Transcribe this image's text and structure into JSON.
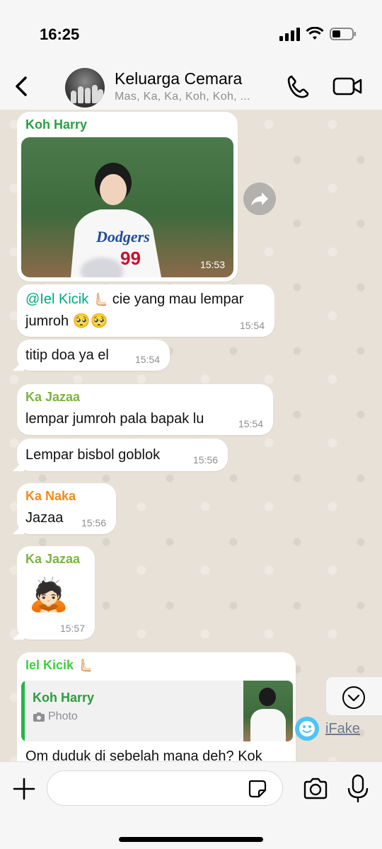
{
  "status": {
    "time": "16:25"
  },
  "header": {
    "title": "Keluarga Cemara",
    "members": "Mas, Ka, Ka, Koh, Koh, ..."
  },
  "messages": [
    {
      "sender": "Koh Harry",
      "sender_color": "#25a244",
      "type": "photo",
      "time": "15:53"
    },
    {
      "mention": "@Iel Kicik",
      "mention_emoji": "🫷🏻",
      "text_line1": " cie yang mau lempar",
      "text_line2": "jumroh 🥺🥺",
      "time": "15:54"
    },
    {
      "text": "titip doa ya el",
      "time": "15:54"
    },
    {
      "sender": "Ka Jazaa",
      "sender_color": "#7cb342",
      "text": "lempar jumroh pala bapak lu",
      "time": "15:54"
    },
    {
      "text": "Lempar bisbol goblok",
      "time": "15:56"
    },
    {
      "sender": "Ka Naka",
      "sender_color": "#f08c1a",
      "text": "Jazaa",
      "time": "15:56"
    },
    {
      "sender": "Ka Jazaa",
      "sender_color": "#7cb342",
      "sticker": "🙇🏻",
      "time": "15:57"
    },
    {
      "sender": "Iel Kicik",
      "sender_emoji": "🫷🏻",
      "sender_color": "#3fcf3f",
      "quote": {
        "name": "Koh Harry",
        "type": "Photo"
      },
      "text": "Om duduk di sebelah mana deh? Kok"
    }
  ],
  "photo_overlay": {
    "team_text": "Dodgers",
    "number": "99"
  },
  "watermark": {
    "label": "iFake"
  },
  "colors": {
    "accent": "#25a244",
    "chat_bg": "#e8e1d7"
  }
}
